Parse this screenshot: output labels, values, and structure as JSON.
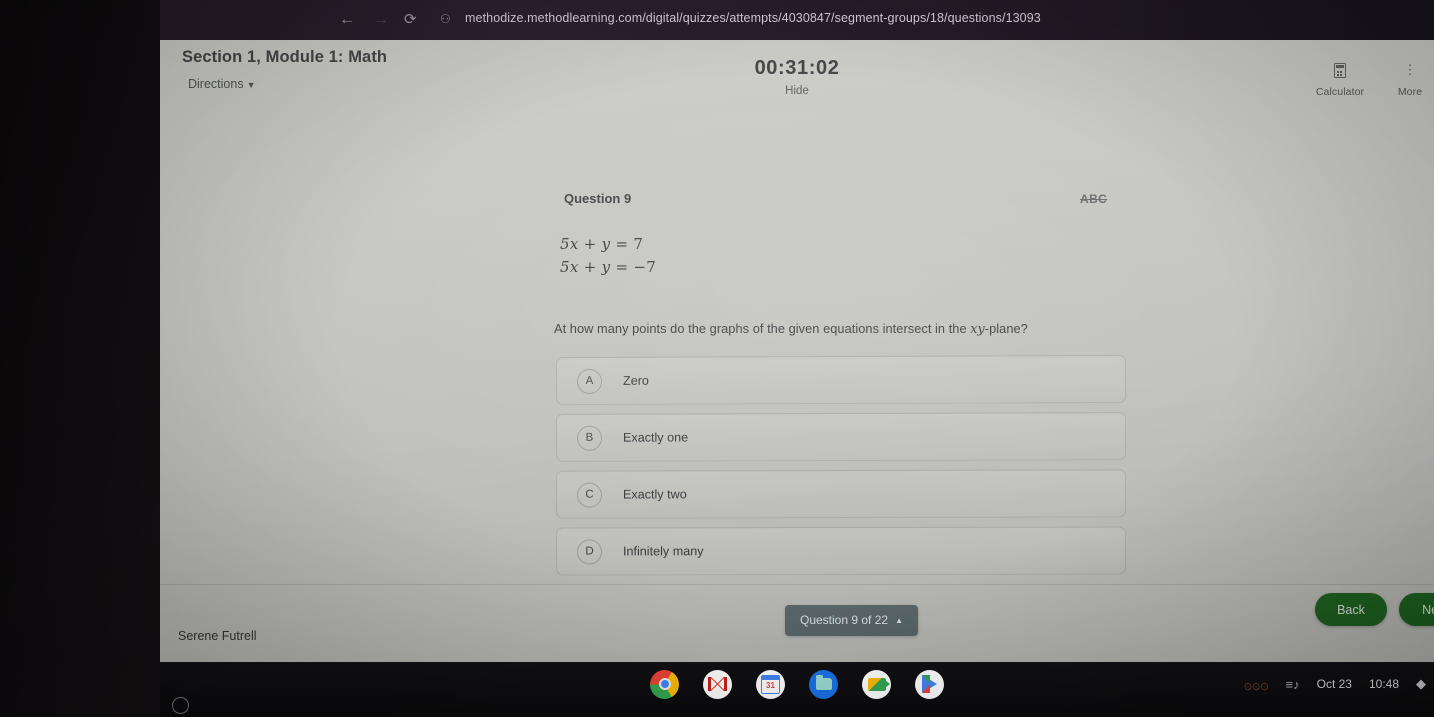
{
  "browser": {
    "url": "methodize.methodlearning.com/digital/quizzes/attempts/4030847/segment-groups/18/questions/13093",
    "back_icon": "←",
    "forward_icon": "→",
    "reload_icon": "⟳",
    "site_info_icon": "⚇",
    "star_icon": "☆"
  },
  "exam": {
    "section_title": "Section 1, Module 1: Math",
    "directions_label": "Directions",
    "directions_caret": "▼",
    "timer": "00:31:02",
    "hide_label": "Hide",
    "tools": [
      {
        "label": "Calculator",
        "icon": "calculator-icon"
      },
      {
        "label": "More",
        "icon": "vertical-dots-icon",
        "glyph": "⋮"
      }
    ]
  },
  "question": {
    "label": "Question 9",
    "crossout_label": "ABC",
    "equations": [
      {
        "lhs": "5x + y",
        "rel": "=",
        "rhs": "7"
      },
      {
        "lhs": "5x + y",
        "rel": "=",
        "rhs": "−7"
      }
    ],
    "prompt_before": "At how many points do the graphs of the given equations intersect in the ",
    "prompt_var": "xy",
    "prompt_after": "-plane?",
    "choices": [
      {
        "letter": "A",
        "text": "Zero"
      },
      {
        "letter": "B",
        "text": "Exactly one"
      },
      {
        "letter": "C",
        "text": "Exactly two"
      },
      {
        "letter": "D",
        "text": "Infinitely many"
      }
    ]
  },
  "footer": {
    "student_name": "Serene Futrell",
    "question_nav": "Question 9 of 22",
    "question_nav_caret": "▲",
    "back_label": "Back",
    "next_label": "Next"
  },
  "shelf": {
    "launcher_icon": "launcher-circle-icon",
    "apps": [
      {
        "name": "chrome",
        "title": "Google Chrome",
        "active": true
      },
      {
        "name": "gmail",
        "title": "Gmail",
        "active": false
      },
      {
        "name": "calendar",
        "title": "Google Calendar",
        "active": false,
        "day": "31"
      },
      {
        "name": "files",
        "title": "Files",
        "active": false
      },
      {
        "name": "meet",
        "title": "Google Meet",
        "active": false
      },
      {
        "name": "play",
        "title": "Play Store",
        "active": false
      }
    ],
    "tray": {
      "notification_glyphs": "۞۞۞",
      "media_icon": "≡♪",
      "date": "Oct 23",
      "time": "10:48",
      "battery_icon": "◆"
    }
  },
  "colors": {
    "page_bg": "#c6c6c2",
    "accent_green": "#1d661f",
    "nav_pill": "#5b6a6e",
    "shelf_bg": "#0d0c0f"
  }
}
